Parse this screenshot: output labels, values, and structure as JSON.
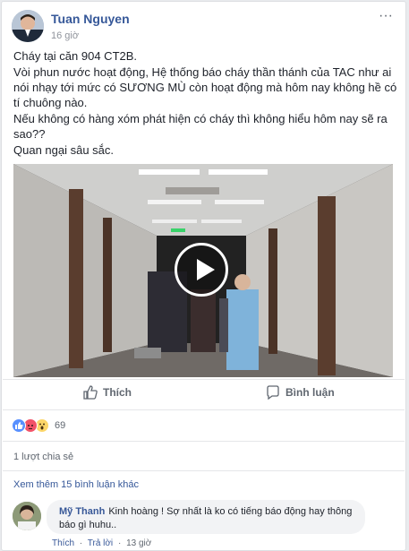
{
  "post": {
    "author": "Tuan Nguyen",
    "time": "16 giờ",
    "more_label": "···",
    "paragraphs": [
      "Cháy tại căn 904 CT2B.",
      "Vòi phun nước hoạt động, Hệ thống báo cháy thần thánh của TAC như ai nói nhạy tới mức có SƯƠNG MÙ còn hoạt động mà hôm nay không hề có tí chuông nào.",
      "Nếu không có hàng xóm phát hiện có cháy thì không hiểu hôm nay sẽ ra sao??",
      "Quan ngại sâu sắc."
    ]
  },
  "video": {
    "icon": "play-icon",
    "progress": 0
  },
  "actions": {
    "like_label": "Thích",
    "comment_label": "Bình luận"
  },
  "reactions": {
    "types": [
      "like",
      "angry",
      "wow"
    ],
    "count": "69"
  },
  "shares": "1 lượt chia sẻ",
  "more_comments": "Xem thêm 15 bình luận khác",
  "comment": {
    "author": "Mỹ Thanh",
    "text": "Kinh hoàng ! Sợ nhất là ko có tiếng báo động hay thông báo gì huhu..",
    "like_label": "Thích",
    "reply_label": "Trả lời",
    "time": "13 giờ",
    "separator": "·"
  },
  "colors": {
    "link": "#365899",
    "like_blue": "#5890ff",
    "angry": "#f25268",
    "wow": "#fcd669"
  }
}
